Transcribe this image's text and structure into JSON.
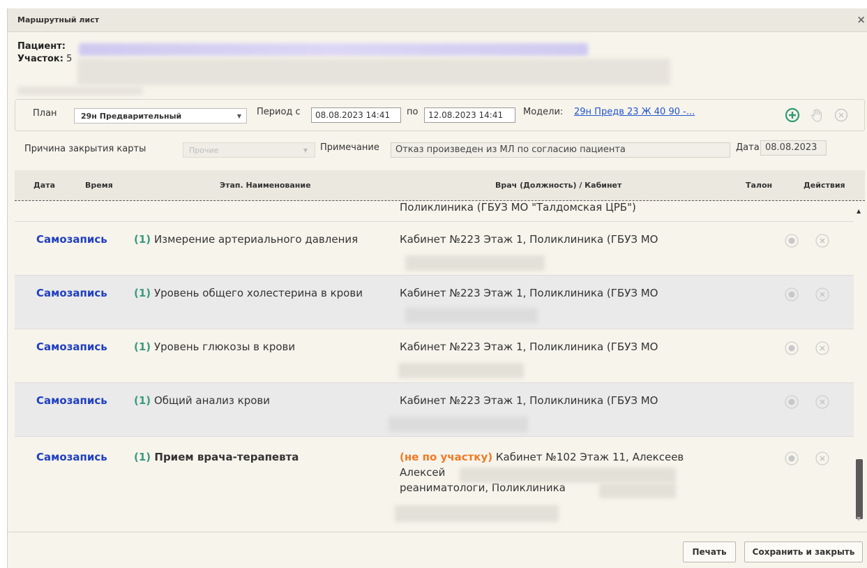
{
  "window": {
    "title": "Маршрутный лист",
    "close": "×"
  },
  "patient": {
    "patient_label": "Пациент:",
    "patient_value": "",
    "area_label": "Участок:",
    "area_value": "5"
  },
  "plan": {
    "plan_label": "План",
    "plan_value": "29н Предварительный",
    "period_from_label": "Период с",
    "period_from": "08.08.2023 14:41",
    "period_to_label": "по",
    "period_to": "12.08.2023 14:41",
    "models_label": "Модели:",
    "models_link": "29н Предв 23 Ж 40 90 -..."
  },
  "closing": {
    "reason_label": "Причина закрытия карты",
    "reason_value": "Прочие",
    "note_label": "Примечание",
    "note_value": "Отказ произведен из МЛ по согласию пациента",
    "date_label": "Дата",
    "date_value": "08.08.2023"
  },
  "table": {
    "headers": {
      "date": "Дата",
      "time": "Время",
      "stage": "Этап. Наименование",
      "doctor": "Врач (Должность) / Кабинет",
      "ticket": "Талон",
      "actions": "Действия"
    },
    "partial_row": {
      "doctor": "Поликлиника (ГБУЗ МО \"Талдомская ЦРБ\")"
    },
    "rows": [
      {
        "action": "Самозапись",
        "count": "(1)",
        "stage": "Измерение артериального давления",
        "doctor": "Кабинет №223 Этаж 1, Поликлиника (ГБУЗ МО"
      },
      {
        "action": "Самозапись",
        "count": "(1)",
        "stage": "Уровень общего холестерина в крови",
        "doctor": "Кабинет №223 Этаж 1, Поликлиника (ГБУЗ МО"
      },
      {
        "action": "Самозапись",
        "count": "(1)",
        "stage": "Уровень глюкозы в крови",
        "doctor": "Кабинет №223 Этаж 1, Поликлиника (ГБУЗ МО"
      },
      {
        "action": "Самозапись",
        "count": "(1)",
        "stage": "Общий анализ крови",
        "doctor": "Кабинет №223 Этаж 1, Поликлиника (ГБУЗ МО"
      },
      {
        "action": "Самозапись",
        "count": "(1)",
        "stage": "Прием врача-терапевта",
        "doctor_flag": "(не по участку)",
        "doctor": "Кабинет №102 Этаж 11, Алексеев",
        "doctor_line2": "Алексей",
        "doctor_line3": "реаниматологи, Поликлиника"
      }
    ]
  },
  "footer": {
    "print": "Печать",
    "save_close": "Сохранить и закрыть"
  },
  "colors": {
    "accent_link": "#1f3fbf",
    "count_green": "#3a9a7f",
    "warning_orange": "#f07a22",
    "add_icon_green": "#2e9a72"
  },
  "icons": [
    "close-icon",
    "add-plus-circle-icon",
    "hand-icon",
    "remove-circle-icon",
    "dropdown-arrow-icon",
    "record-circle-icon",
    "scroll-up-arrow-icon",
    "scroll-down-arrow-icon"
  ]
}
